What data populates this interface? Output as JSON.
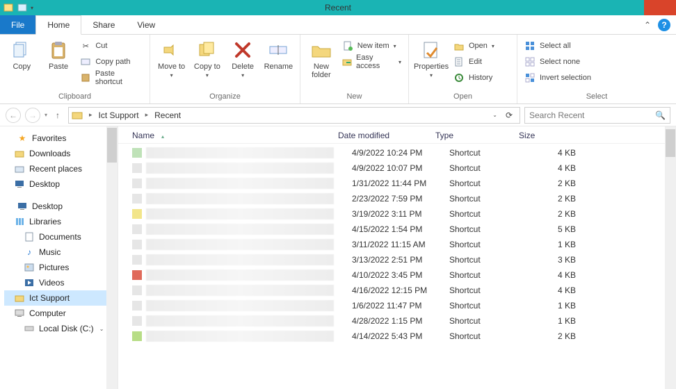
{
  "window": {
    "title": "Recent"
  },
  "tabs": {
    "file": "File",
    "home": "Home",
    "share": "Share",
    "view": "View"
  },
  "ribbon": {
    "clipboard": {
      "label": "Clipboard",
      "copy": "Copy",
      "paste": "Paste",
      "cut": "Cut",
      "copy_path": "Copy path",
      "paste_shortcut": "Paste shortcut"
    },
    "organize": {
      "label": "Organize",
      "move_to": "Move\nto",
      "copy_to": "Copy\nto",
      "delete": "Delete",
      "rename": "Rename"
    },
    "new": {
      "label": "New",
      "new_folder": "New\nfolder",
      "new_item": "New item",
      "easy_access": "Easy access"
    },
    "open": {
      "label": "Open",
      "properties": "Properties",
      "open": "Open",
      "edit": "Edit",
      "history": "History"
    },
    "select": {
      "label": "Select",
      "select_all": "Select all",
      "select_none": "Select none",
      "invert": "Invert selection"
    }
  },
  "breadcrumb": {
    "seg1": "Ict Support",
    "seg2": "Recent"
  },
  "search": {
    "placeholder": "Search Recent"
  },
  "tree": {
    "favorites": "Favorites",
    "downloads": "Downloads",
    "recent_places": "Recent places",
    "desktop_fav": "Desktop",
    "desktop": "Desktop",
    "libraries": "Libraries",
    "documents": "Documents",
    "music": "Music",
    "pictures": "Pictures",
    "videos": "Videos",
    "ict_support": "Ict Support",
    "computer": "Computer",
    "local_disk": "Local Disk (C:)"
  },
  "columns": {
    "name": "Name",
    "date": "Date modified",
    "type": "Type",
    "size": "Size"
  },
  "rows": [
    {
      "swatch": "#bfe2b8",
      "date": "4/9/2022 10:24 PM",
      "type": "Shortcut",
      "size": "4 KB"
    },
    {
      "swatch": "#e6e6e6",
      "date": "4/9/2022 10:07 PM",
      "type": "Shortcut",
      "size": "4 KB"
    },
    {
      "swatch": "#e6e6e6",
      "date": "1/31/2022 11:44 PM",
      "type": "Shortcut",
      "size": "2 KB"
    },
    {
      "swatch": "#e6e6e6",
      "date": "2/23/2022 7:59 PM",
      "type": "Shortcut",
      "size": "2 KB"
    },
    {
      "swatch": "#f2e58a",
      "date": "3/19/2022 3:11 PM",
      "type": "Shortcut",
      "size": "2 KB"
    },
    {
      "swatch": "#e6e6e6",
      "date": "4/15/2022 1:54 PM",
      "type": "Shortcut",
      "size": "5 KB"
    },
    {
      "swatch": "#e6e6e6",
      "date": "3/11/2022 11:15 AM",
      "type": "Shortcut",
      "size": "1 KB"
    },
    {
      "swatch": "#e6e6e6",
      "date": "3/13/2022 2:51 PM",
      "type": "Shortcut",
      "size": "3 KB"
    },
    {
      "swatch": "#e06a5a",
      "date": "4/10/2022 3:45 PM",
      "type": "Shortcut",
      "size": "4 KB"
    },
    {
      "swatch": "#e6e6e6",
      "date": "4/16/2022 12:15 PM",
      "type": "Shortcut",
      "size": "4 KB"
    },
    {
      "swatch": "#e6e6e6",
      "date": "1/6/2022 11:47 PM",
      "type": "Shortcut",
      "size": "1 KB"
    },
    {
      "swatch": "#e6e6e6",
      "date": "4/28/2022 1:15 PM",
      "type": "Shortcut",
      "size": "1 KB"
    },
    {
      "swatch": "#b7dd86",
      "date": "4/14/2022 5:43 PM",
      "type": "Shortcut",
      "size": "2 KB"
    }
  ]
}
